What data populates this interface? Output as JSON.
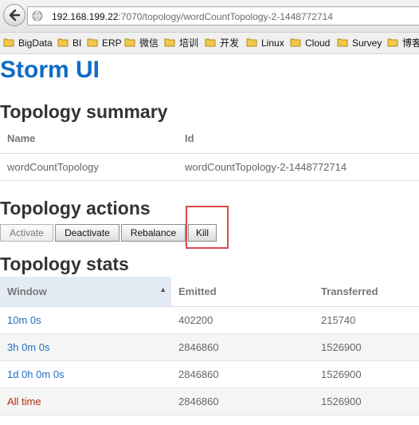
{
  "browser": {
    "url_host": "192.168.199.22",
    "url_path": ":7070/topology/wordCountTopology-2-1448772714",
    "bookmarks": [
      {
        "label": "BigData"
      },
      {
        "label": "BI"
      },
      {
        "label": "ERP"
      },
      {
        "label": "微信"
      },
      {
        "label": "培训"
      },
      {
        "label": "开发"
      },
      {
        "label": "Linux"
      },
      {
        "label": "Cloud"
      },
      {
        "label": "Survey"
      },
      {
        "label": "博客"
      }
    ]
  },
  "page": {
    "title": "Storm UI"
  },
  "summary": {
    "heading": "Topology summary",
    "columns": [
      "Name",
      "Id"
    ],
    "row": {
      "name": "wordCountTopology",
      "id": "wordCountTopology-2-1448772714"
    }
  },
  "actions": {
    "heading": "Topology actions",
    "buttons": [
      "Activate",
      "Deactivate",
      "Rebalance",
      "Kill"
    ]
  },
  "stats": {
    "heading": "Topology stats",
    "columns": [
      "Window",
      "Emitted",
      "Transferred"
    ],
    "rows": [
      {
        "window": "10m 0s",
        "emitted": "402200",
        "transferred": "215740"
      },
      {
        "window": "3h 0m 0s",
        "emitted": "2846860",
        "transferred": "1526900"
      },
      {
        "window": "1d 0h 0m 0s",
        "emitted": "2846860",
        "transferred": "1526900"
      },
      {
        "window": "All time",
        "emitted": "2846860",
        "transferred": "1526900"
      }
    ]
  },
  "colors": {
    "title_blue": "#0e6bc8",
    "link_blue": "#1f6fc1",
    "all_time_red": "#b32d14",
    "highlight_red": "#d94b4b"
  }
}
